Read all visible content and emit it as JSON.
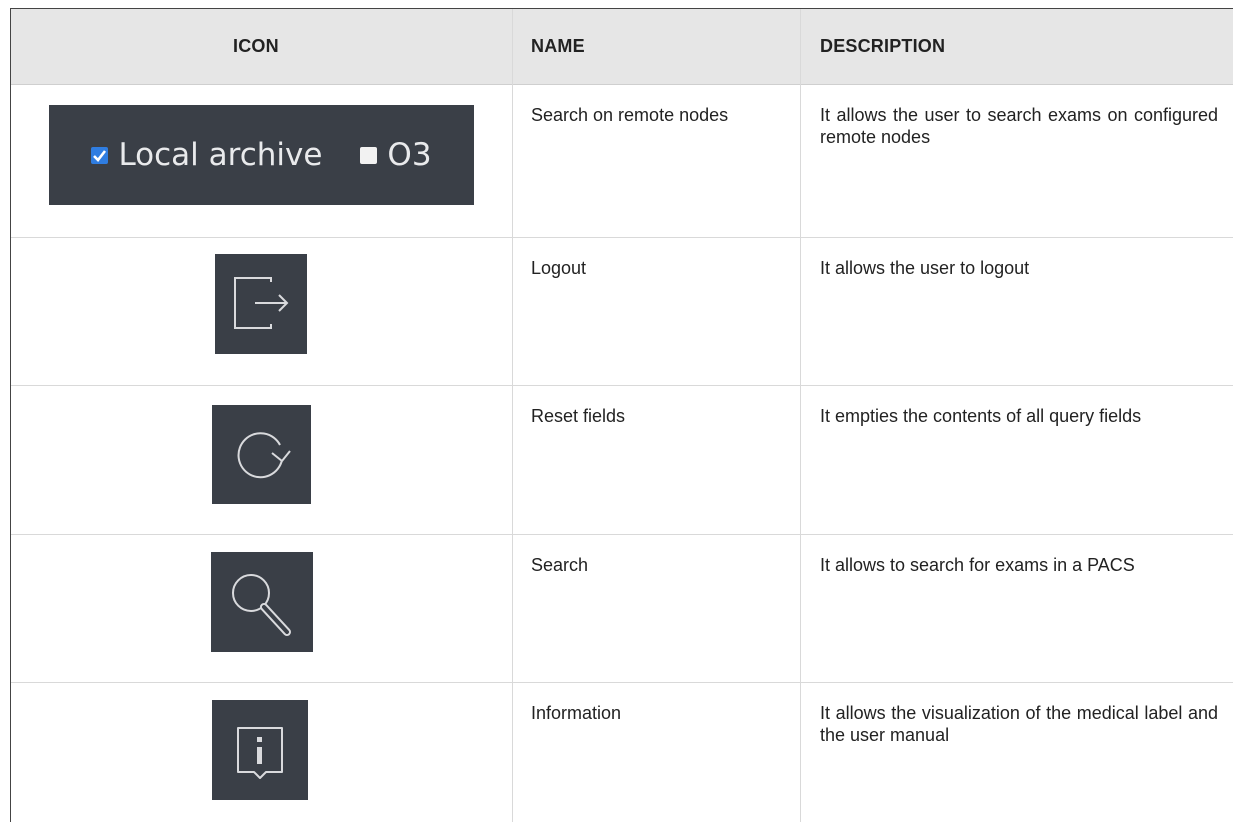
{
  "header": {
    "icon": "ICON",
    "name": "NAME",
    "description": "DESCRIPTION"
  },
  "rows": [
    {
      "icon": "checkbox-group-icon",
      "name": "Search on remote nodes",
      "description": "It allows the user to search exams on configured remote nodes",
      "checkboxes": [
        {
          "label": "Local archive",
          "checked": true
        },
        {
          "label": "O3",
          "checked": false
        }
      ]
    },
    {
      "icon": "logout-icon",
      "name": "Logout",
      "description": "It allows the user to logout"
    },
    {
      "icon": "reset-icon",
      "name": "Reset fields",
      "description": "It empties the contents of all query fields"
    },
    {
      "icon": "search-icon",
      "name": "Search",
      "description": "It allows to search for exams in a PACS"
    },
    {
      "icon": "info-icon",
      "name": "Information",
      "description": "It allows the visualization of the medical label and the user manual"
    }
  ],
  "colors": {
    "icon_bg": "#3a3f47",
    "header_bg": "#e6e6e6",
    "checkbox_checked": "#2f7de1"
  }
}
